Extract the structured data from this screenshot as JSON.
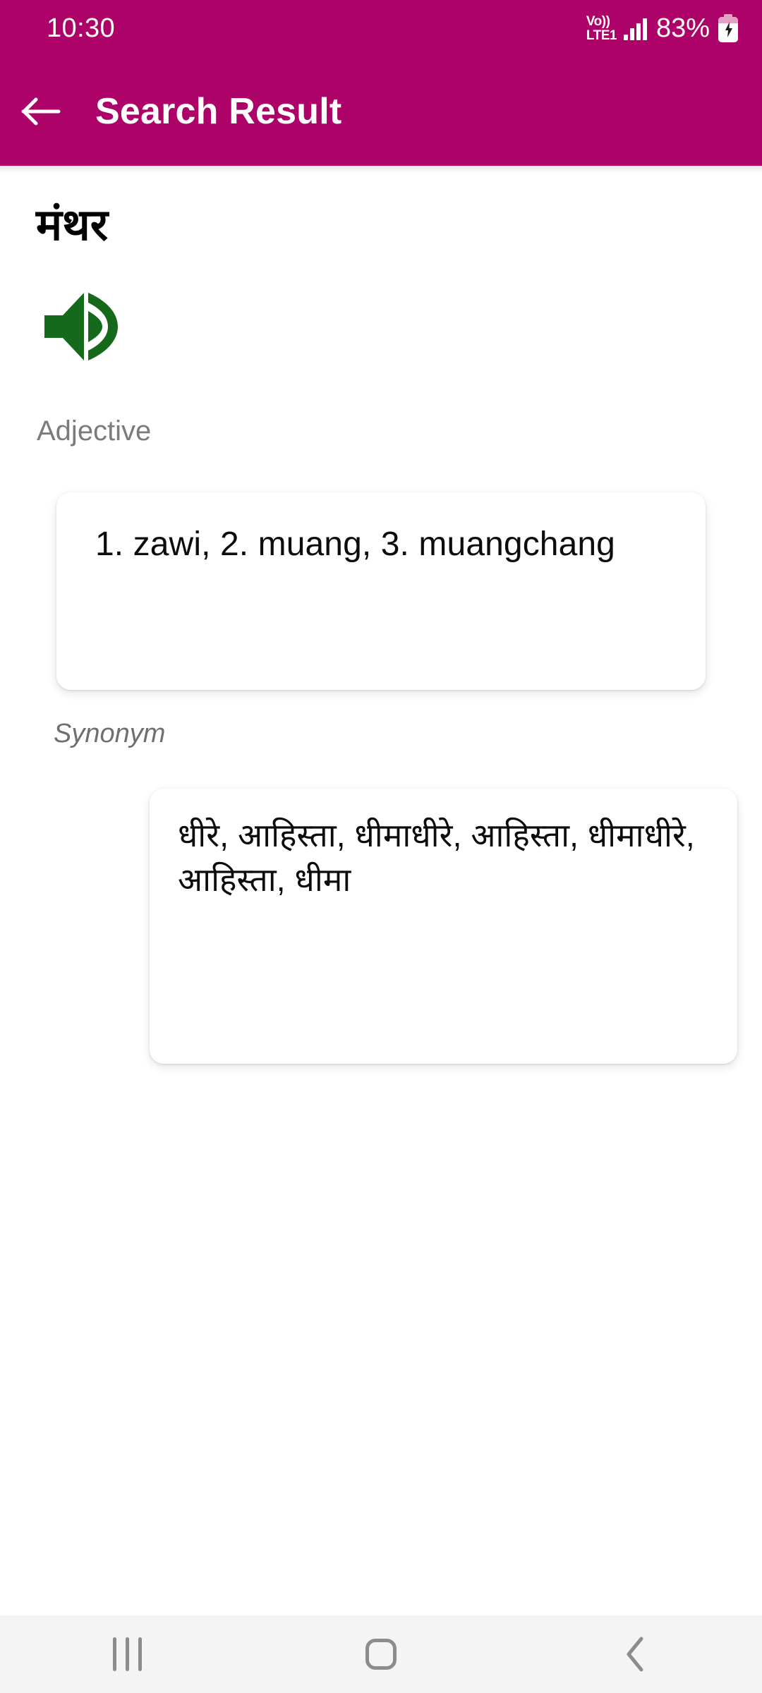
{
  "status_bar": {
    "clock": "10:30",
    "network_top": "Vo))",
    "network_bottom": "LTE1",
    "battery_percent": "83%",
    "signal_icon": "signal-bars-icon",
    "battery_icon": "battery-charging-icon",
    "volte_icon": "volte-icon"
  },
  "toolbar": {
    "title": "Search Result",
    "back_icon": "arrow-left-icon",
    "background_color": "#ad0369",
    "text_color": "#ffffff"
  },
  "entry": {
    "headword": "मंथर",
    "pronounce_icon": "speaker-volume-icon",
    "pronounce_icon_color": "#14691a",
    "part_of_speech_label": "Adjective",
    "definition": "1. zawi, 2. muang, 3. muangchang",
    "synonym_label": "Synonym",
    "synonyms": "धीरे, आहिस्ता, धीमाधीरे, आहिस्ता, धीमाधीरे, आहिस्ता, धीमा"
  },
  "nav_bar": {
    "recents_icon": "recents-icon",
    "home_icon": "home-icon",
    "back_icon": "chevron-left-icon",
    "background_color": "#f4f4f4",
    "icon_color": "#8c8c8c"
  }
}
